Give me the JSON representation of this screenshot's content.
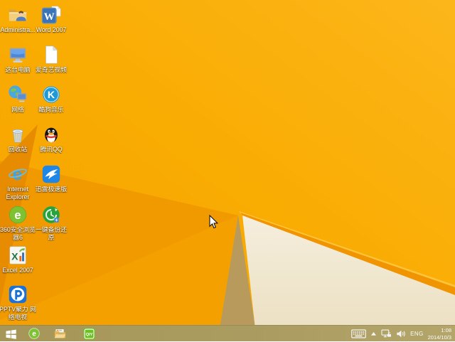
{
  "desktop": {
    "icons": [
      {
        "id": "administrator-folder",
        "label": "Administra...",
        "row": 0,
        "col": 0
      },
      {
        "id": "word-2007",
        "label": "Word 2007",
        "row": 0,
        "col": 1
      },
      {
        "id": "this-pc",
        "label": "这台电脑",
        "row": 1,
        "col": 0
      },
      {
        "id": "iqiyi-video-doc",
        "label": "爱奇艺视频",
        "row": 1,
        "col": 1
      },
      {
        "id": "network",
        "label": "网络",
        "row": 2,
        "col": 0
      },
      {
        "id": "kugou-music",
        "label": "酷狗音乐",
        "row": 2,
        "col": 1
      },
      {
        "id": "recycle-bin",
        "label": "回收站",
        "row": 3,
        "col": 0
      },
      {
        "id": "tencent-qq",
        "label": "腾讯QQ",
        "row": 3,
        "col": 1
      },
      {
        "id": "internet-explorer",
        "label": "Internet Explorer",
        "row": 4,
        "col": 0
      },
      {
        "id": "thunder-speed",
        "label": "迅雷极速版",
        "row": 4,
        "col": 1
      },
      {
        "id": "browser-360",
        "label": "360安全浏览器6",
        "row": 5,
        "col": 0
      },
      {
        "id": "onekey-backup",
        "label": "一键备份还原",
        "row": 5,
        "col": 1
      },
      {
        "id": "excel-2007",
        "label": "Excel 2007",
        "row": 6,
        "col": 0
      },
      {
        "id": "pptv",
        "label": "PPTV聚力 网络电视",
        "row": 7,
        "col": 0
      }
    ]
  },
  "taskbar": {
    "apps": [
      {
        "id": "start",
        "name": "start-button"
      },
      {
        "id": "browser-360-task",
        "name": "taskbar-360-browser-button"
      },
      {
        "id": "file-explorer",
        "name": "taskbar-file-explorer-button"
      },
      {
        "id": "iqiyi-app",
        "name": "taskbar-iqiyi-button"
      }
    ],
    "tray": {
      "language": "ENG",
      "time": "1:08",
      "date": "2014/10/3",
      "icons": [
        "touch-keyboard-icon",
        "show-hidden-icons-icon",
        "network-status-icon",
        "volume-icon"
      ]
    }
  },
  "icon_glyphs": {
    "word": "W",
    "excel": "X",
    "kugou": "K",
    "ie": "e",
    "browser360": "e",
    "iqiyi": "QIY"
  },
  "colors": {
    "wallpaper_base": "#f8ab02",
    "wallpaper_light": "#fcb61a",
    "wallpaper_mid": "#f09a00",
    "wallpaper_fan": "#f3a000",
    "wallpaper_dark_wedge": "#e78c01",
    "wallpaper_tan": "#b89b5c",
    "wallpaper_cream": "#f5eedd",
    "wallpaper_cream_deep": "#ebdfc0",
    "fold_edge": "#f09400",
    "fold_edge_highlight": "#ffc43c",
    "taskbar_left": "#a69658",
    "taskbar_right": "#b4a66a",
    "tray_text": "#fafafa",
    "icon_label_text": "#ffffff"
  }
}
